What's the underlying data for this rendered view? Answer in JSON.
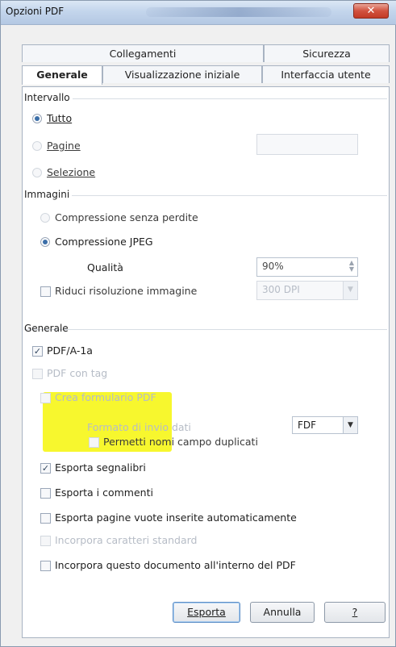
{
  "window": {
    "title": "Opzioni PDF",
    "close_glyph": "✕"
  },
  "tabs": {
    "row1": [
      "Collegamenti",
      "Sicurezza"
    ],
    "row2": [
      "Generale",
      "Visualizzazione iniziale",
      "Interfaccia utente"
    ],
    "active": "Generale"
  },
  "intervallo": {
    "label": "Intervallo",
    "options": [
      {
        "label": "Tutto",
        "selected": true,
        "enabled": true
      },
      {
        "label": "Pagine",
        "selected": false,
        "enabled": false
      },
      {
        "label": "Selezione",
        "selected": false,
        "enabled": false
      }
    ],
    "pages_value": ""
  },
  "immagini": {
    "label": "Immagini",
    "options": [
      {
        "label": "Compressione senza perdite",
        "selected": false,
        "enabled": false
      },
      {
        "label": "Compressione JPEG",
        "selected": true,
        "enabled": true
      }
    ],
    "qualita_label": "Qualità",
    "qualita_value": "90%",
    "riduci_label": "Riduci risoluzione immagine",
    "riduci_checked": false,
    "dpi_value": "300 DPI"
  },
  "generale": {
    "label": "Generale",
    "pdfa_label": "PDF/A-1a",
    "pdfa_checked": true,
    "tagged_label": "PDF con tag",
    "form_label": "Crea formulario PDF",
    "submit_format_label": "Formato di invio dati",
    "submit_format_value": "FDF",
    "dup_label": "Permetti nomi campo duplicati",
    "bookmarks_label": "Esporta segnalibri",
    "bookmarks_checked": true,
    "comments_label": "Esporta i commenti",
    "comments_checked": false,
    "blank_label": "Esporta pagine vuote inserite automaticamente",
    "blank_checked": false,
    "fonts_label": "Incorpora caratteri standard",
    "embed_label": "Incorpora questo documento all'interno del PDF",
    "embed_checked": false
  },
  "buttons": {
    "export": "Esporta",
    "cancel": "Annulla",
    "help": "?"
  },
  "colors": {
    "highlight": "#f5f500",
    "radio_dot": "#3b6ea8",
    "disabled_text": "#b6bcc6"
  }
}
